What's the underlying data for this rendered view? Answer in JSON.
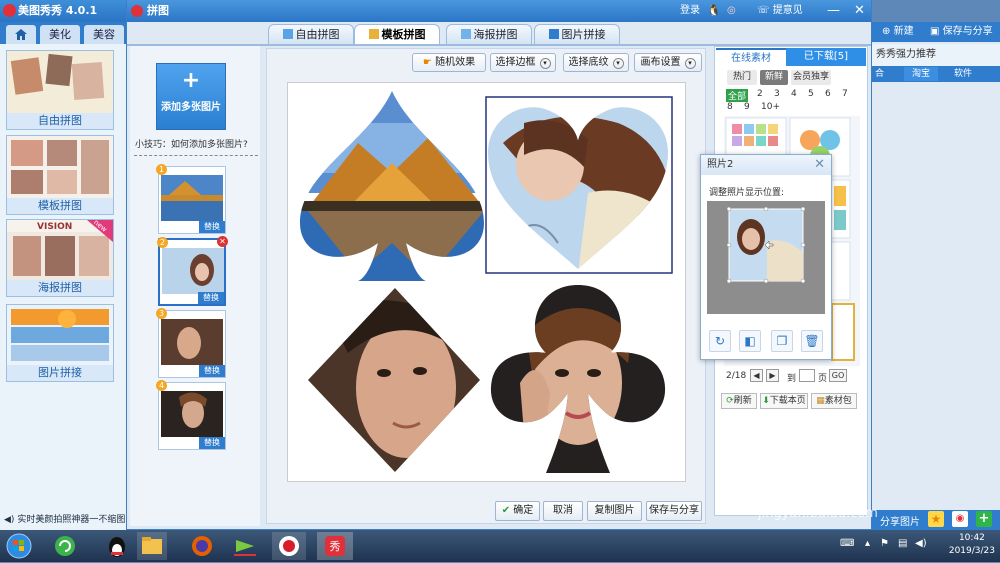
{
  "bg_app": {
    "title": "美图秀秀 4.0.1",
    "tabs": [
      "美化",
      "美容"
    ],
    "home_icon": "home-icon"
  },
  "bg_left_items": [
    {
      "label": "自由拼图"
    },
    {
      "label": "模板拼图"
    },
    {
      "label": "海报拼图"
    },
    {
      "label": "图片拼接"
    }
  ],
  "bg_left_tip": "实时美颜拍照神器一不缩图",
  "right_bg": {
    "new_label": "新建",
    "save_share_label": "保存与分享",
    "recommend": "秀秀强力推荐",
    "cats": [
      "合",
      "淘宝",
      "软件"
    ],
    "share_pic": "分享图片"
  },
  "window": {
    "title": "拼图",
    "login": "登录",
    "feedback": "提意见",
    "tabs": [
      "自由拼图",
      "模板拼图",
      "海报拼图",
      "图片拼接"
    ],
    "active_tab": 1
  },
  "left_panel": {
    "add_button": "添加多张图片",
    "hint": "小技巧：如何添加多张图片?",
    "thumbs": [
      {
        "num": "1",
        "replace": "替换"
      },
      {
        "num": "2",
        "replace": "替换"
      },
      {
        "num": "3",
        "replace": "替换"
      },
      {
        "num": "4",
        "replace": "替换"
      }
    ]
  },
  "toolbar": {
    "random": "随机效果",
    "border": "选择边框",
    "texture": "选择底纹",
    "canvas": "画布设置"
  },
  "bottom_buttons": {
    "confirm": "确定",
    "cancel": "取消",
    "copy": "复制图片",
    "save": "保存与分享"
  },
  "material": {
    "tab_online": "在线素材",
    "tab_downloaded": "已下载[5]",
    "chips": [
      "热门",
      "新鲜",
      "会员独享"
    ],
    "pages": [
      "全部",
      "2",
      "3",
      "4",
      "5",
      "6",
      "7",
      "8",
      "9",
      "10+"
    ],
    "pager": "2/18",
    "goto_label": "到",
    "page_label": "页",
    "go": "GO",
    "refresh": "刷新",
    "download_page": "下载本页",
    "pack": "素材包"
  },
  "popup": {
    "title": "照片2",
    "label": "调整照片显示位置:"
  },
  "taskbar": {
    "time": "10:42",
    "date": "2019/3/23"
  },
  "watermark": {
    "text": "Bai经验",
    "sub": "jingyan.baidu.com"
  },
  "colors": {
    "accent": "#2b76c6",
    "title_bar": "#3f8fd8",
    "red_logo": "#e0303a"
  }
}
